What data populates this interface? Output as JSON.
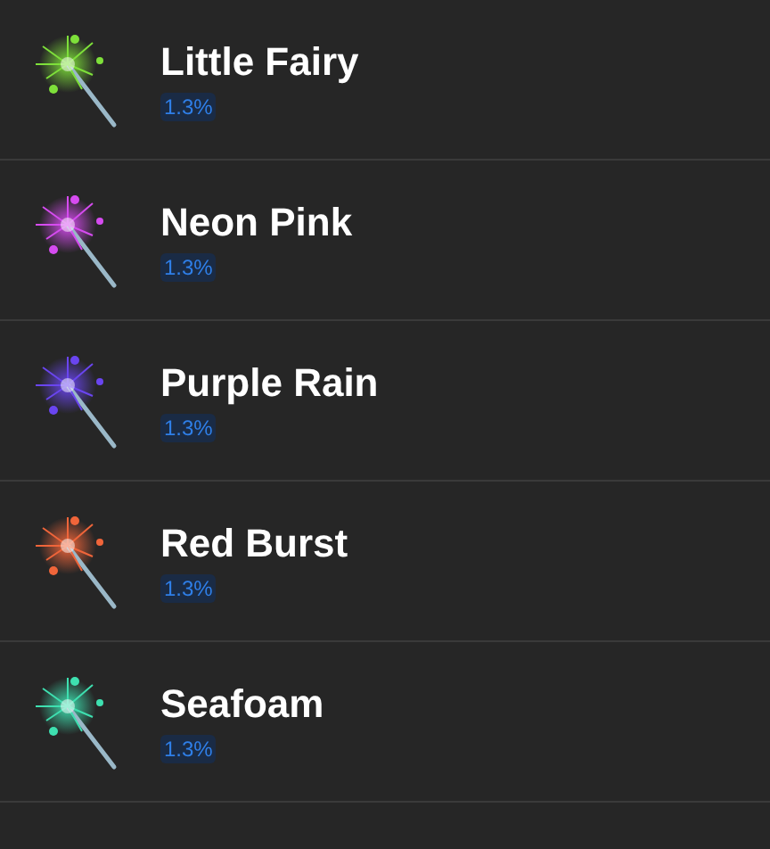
{
  "effects": [
    {
      "name": "Little Fairy",
      "share": "1.3%",
      "color": "#7ee03a"
    },
    {
      "name": "Neon Pink",
      "share": "1.3%",
      "color": "#d64bf0"
    },
    {
      "name": "Purple Rain",
      "share": "1.3%",
      "color": "#6a45f0"
    },
    {
      "name": "Red Burst",
      "share": "1.3%",
      "color": "#f0653a"
    },
    {
      "name": "Seafoam",
      "share": "1.3%",
      "color": "#3ee0b0"
    }
  ]
}
